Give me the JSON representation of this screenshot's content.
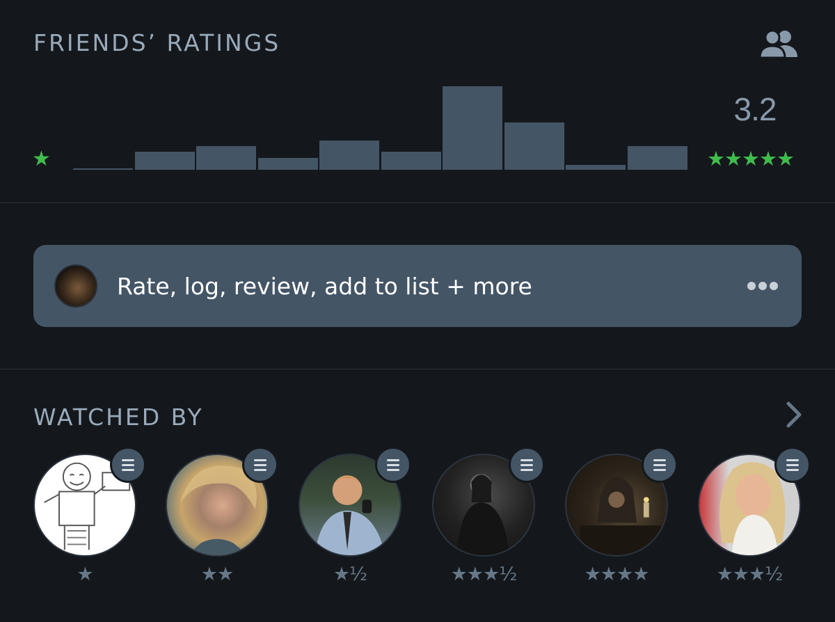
{
  "ratings": {
    "title": "FRIENDS’ RATINGS",
    "average": "3.2",
    "min_label": "★",
    "max_label": "★★★★★",
    "histogram": {
      "type": "bar",
      "categories": [
        "½",
        "★",
        "★½",
        "★★",
        "★★½",
        "★★★",
        "★★★½",
        "★★★★",
        "★★★★½",
        "★★★★★"
      ],
      "values": [
        0.2,
        2.2,
        2.8,
        1.4,
        3.5,
        2.2,
        10,
        5.7,
        0.6,
        2.8
      ]
    },
    "accent_color": "#40bc4c"
  },
  "action_bar": {
    "label": "Rate, log, review, add to list + more"
  },
  "watched_by": {
    "title": "WATCHED BY",
    "users": [
      {
        "rating": "★",
        "avatar": "drawing-avatar"
      },
      {
        "rating": "★★",
        "avatar": "blonde-actor-avatar"
      },
      {
        "rating": "★½",
        "avatar": "phone-man-avatar"
      },
      {
        "rating": "★★★½",
        "avatar": "dark-suit-avatar"
      },
      {
        "rating": "★★★★",
        "avatar": "hooded-figure-avatar"
      },
      {
        "rating": "★★★½",
        "avatar": "blonde-woman-avatar"
      }
    ]
  }
}
